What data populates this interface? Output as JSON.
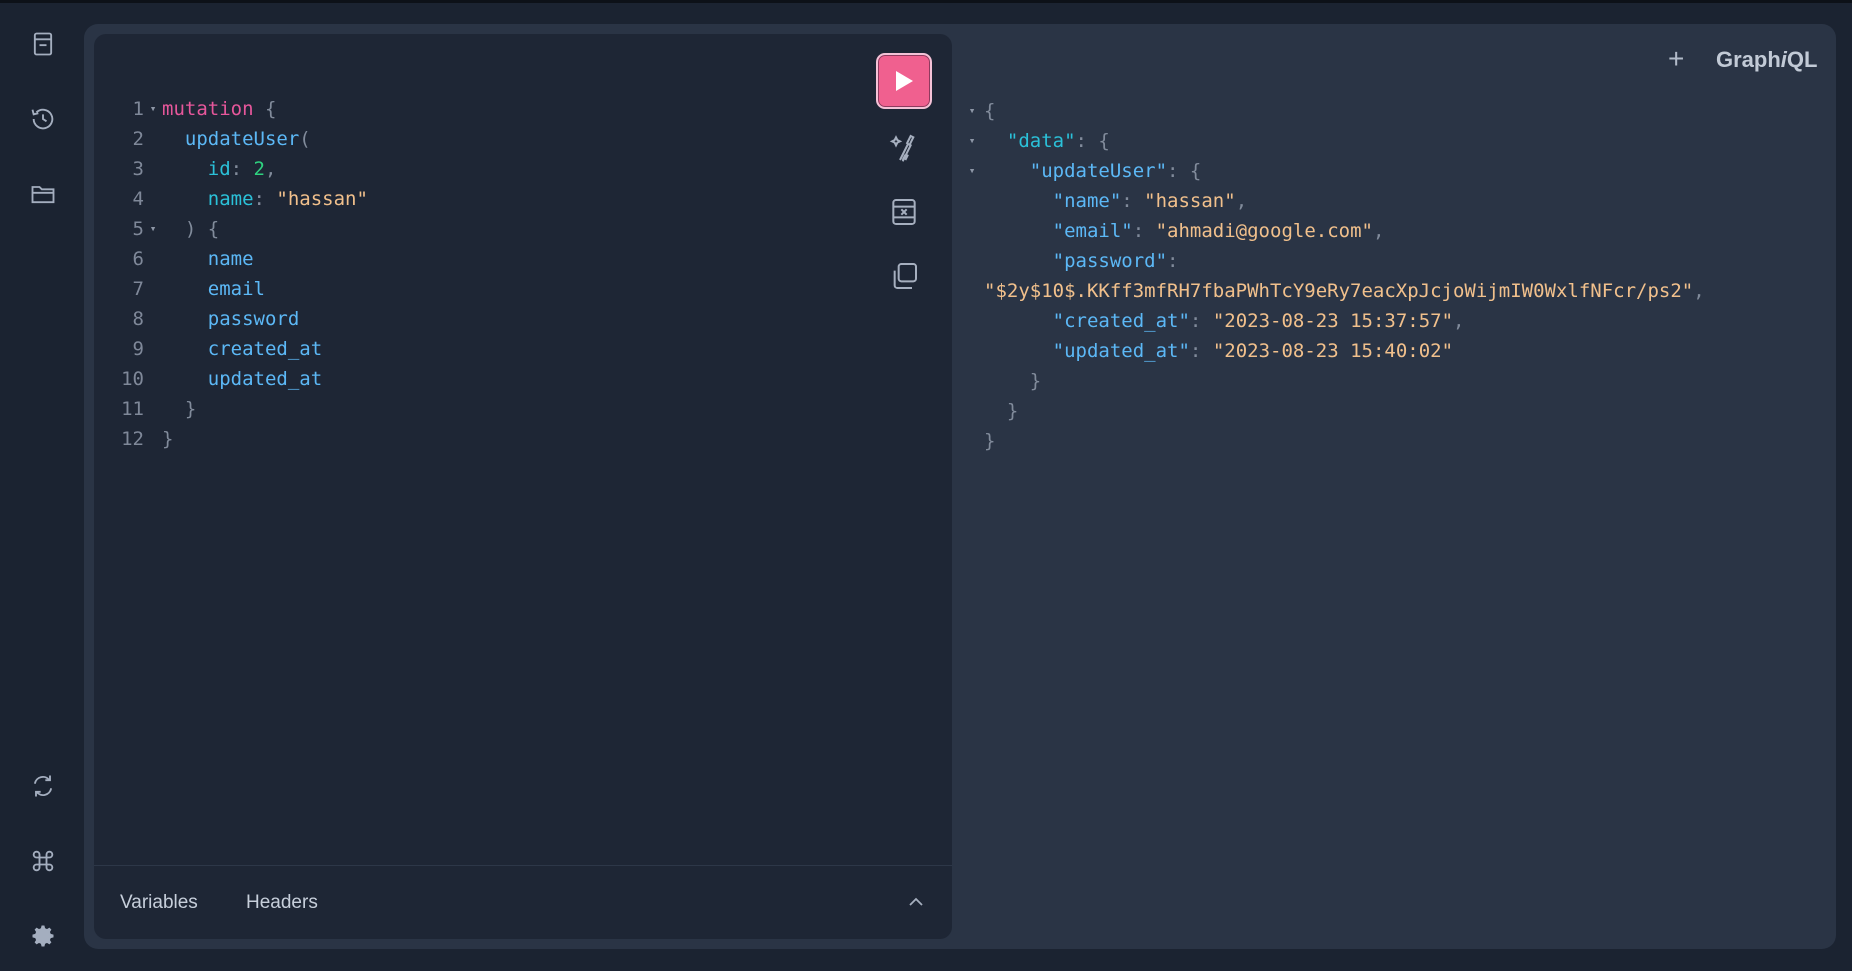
{
  "sidebar": {
    "icons": [
      "docs-icon",
      "history-icon",
      "explorer-icon",
      "refresh-icon",
      "shortcuts-icon",
      "settings-icon"
    ]
  },
  "editor": {
    "lines": [
      {
        "n": "1",
        "fold": "▾",
        "parts": [
          [
            "kw",
            "mutation"
          ],
          [
            "pun",
            " {"
          ]
        ]
      },
      {
        "n": "2",
        "fold": "",
        "parts": [
          [
            "sp",
            "  "
          ],
          [
            "fn",
            "updateUser"
          ],
          [
            "pun",
            "("
          ]
        ]
      },
      {
        "n": "3",
        "fold": "",
        "parts": [
          [
            "sp",
            "    "
          ],
          [
            "arg",
            "id"
          ],
          [
            "pun",
            ": "
          ],
          [
            "num",
            "2"
          ],
          [
            "pun",
            ","
          ]
        ]
      },
      {
        "n": "4",
        "fold": "",
        "parts": [
          [
            "sp",
            "    "
          ],
          [
            "arg",
            "name"
          ],
          [
            "pun",
            ": "
          ],
          [
            "str",
            "\"hassan\""
          ]
        ]
      },
      {
        "n": "5",
        "fold": "▾",
        "parts": [
          [
            "sp",
            "  "
          ],
          [
            "pun",
            ") {"
          ]
        ]
      },
      {
        "n": "6",
        "fold": "",
        "parts": [
          [
            "sp",
            "    "
          ],
          [
            "fn",
            "name"
          ]
        ]
      },
      {
        "n": "7",
        "fold": "",
        "parts": [
          [
            "sp",
            "    "
          ],
          [
            "fn",
            "email"
          ]
        ]
      },
      {
        "n": "8",
        "fold": "",
        "parts": [
          [
            "sp",
            "    "
          ],
          [
            "fn",
            "password"
          ]
        ]
      },
      {
        "n": "9",
        "fold": "",
        "parts": [
          [
            "sp",
            "    "
          ],
          [
            "fn",
            "created_at"
          ]
        ]
      },
      {
        "n": "10",
        "fold": "",
        "parts": [
          [
            "sp",
            "    "
          ],
          [
            "fn",
            "updated_at"
          ]
        ]
      },
      {
        "n": "11",
        "fold": "",
        "parts": [
          [
            "sp",
            "  "
          ],
          [
            "pun",
            "}"
          ]
        ]
      },
      {
        "n": "12",
        "fold": "",
        "parts": [
          [
            "pun",
            "}"
          ]
        ]
      }
    ]
  },
  "toolbar": {
    "run": "run-query",
    "prettify": "prettify",
    "merge": "merge-fragments",
    "copy": "copy-query"
  },
  "bottom": {
    "variables_label": "Variables",
    "headers_label": "Headers"
  },
  "result": {
    "lines": [
      {
        "fold": "▾",
        "parts": [
          [
            "pun",
            "{"
          ]
        ]
      },
      {
        "fold": "▾",
        "parts": [
          [
            "sp",
            "  "
          ],
          [
            "key-data",
            "\"data\""
          ],
          [
            "pun",
            ": {"
          ]
        ]
      },
      {
        "fold": "▾",
        "parts": [
          [
            "sp",
            "    "
          ],
          [
            "key",
            "\"updateUser\""
          ],
          [
            "pun",
            ": {"
          ]
        ]
      },
      {
        "fold": "",
        "parts": [
          [
            "sp",
            "      "
          ],
          [
            "key",
            "\"name\""
          ],
          [
            "pun",
            ": "
          ],
          [
            "str",
            "\"hassan\""
          ],
          [
            "pun",
            ","
          ]
        ]
      },
      {
        "fold": "",
        "parts": [
          [
            "sp",
            "      "
          ],
          [
            "key",
            "\"email\""
          ],
          [
            "pun",
            ": "
          ],
          [
            "str",
            "\"ahmadi@google.com\""
          ],
          [
            "pun",
            ","
          ]
        ]
      },
      {
        "fold": "",
        "parts": [
          [
            "sp",
            "      "
          ],
          [
            "key",
            "\"password\""
          ],
          [
            "pun",
            ":"
          ]
        ]
      },
      {
        "fold": "",
        "parts": [
          [
            "str",
            "\"$2y$10$.KKff3mfRH7fbaPWhTcY9eRy7eacXpJcjoWijmIW0WxlfNFcr/ps2\""
          ],
          [
            "pun",
            ","
          ]
        ]
      },
      {
        "fold": "",
        "parts": [
          [
            "sp",
            "      "
          ],
          [
            "key",
            "\"created_at\""
          ],
          [
            "pun",
            ": "
          ],
          [
            "str",
            "\"2023-08-23 15:37:57\""
          ],
          [
            "pun",
            ","
          ]
        ]
      },
      {
        "fold": "",
        "parts": [
          [
            "sp",
            "      "
          ],
          [
            "key",
            "\"updated_at\""
          ],
          [
            "pun",
            ": "
          ],
          [
            "str",
            "\"2023-08-23 15:40:02\""
          ]
        ]
      },
      {
        "fold": "",
        "parts": [
          [
            "sp",
            "    "
          ],
          [
            "pun",
            "}"
          ]
        ]
      },
      {
        "fold": "",
        "parts": [
          [
            "sp",
            "  "
          ],
          [
            "pun",
            "}"
          ]
        ]
      },
      {
        "fold": "",
        "parts": [
          [
            "pun",
            "}"
          ]
        ]
      }
    ]
  },
  "header": {
    "add_tab": "+",
    "brand_a": "Graph",
    "brand_b": "i",
    "brand_c": "QL"
  }
}
